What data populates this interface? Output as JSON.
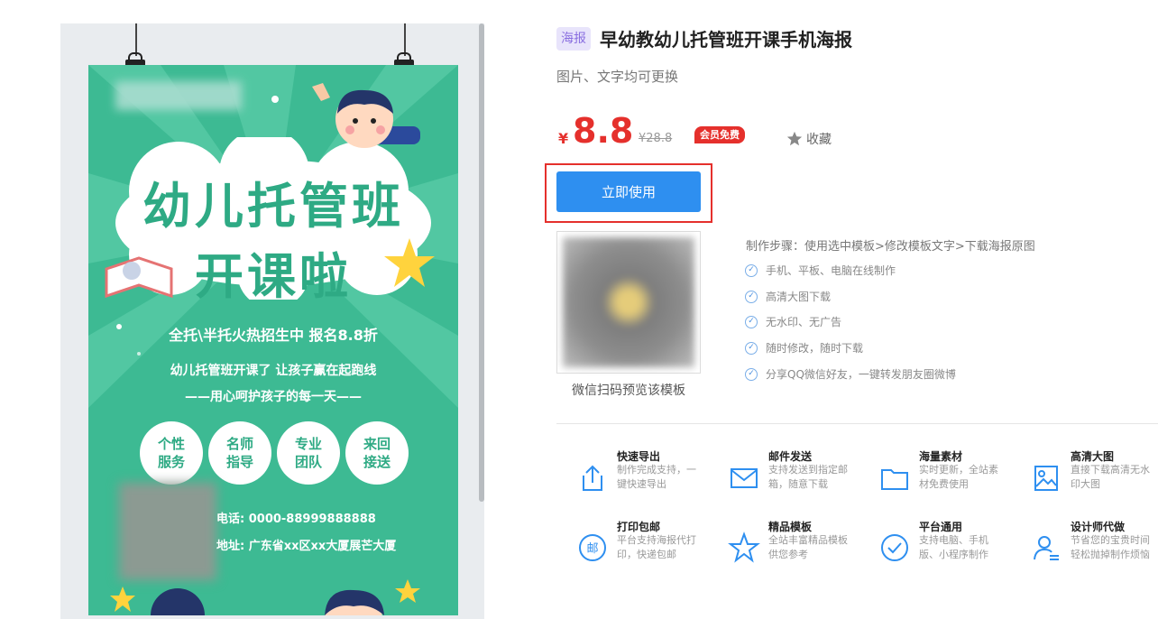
{
  "preview": {
    "poster": {
      "title_line1": "幼儿托管班",
      "title_line2": "开课啦",
      "line1": "全托\\半托火热招生中 报名8.8折",
      "line2": "幼儿托管班开课了 让孩子赢在起跑线",
      "line3": "——用心呵护孩子的每一天——",
      "circles": [
        {
          "line1": "个性",
          "line2": "服务"
        },
        {
          "line1": "名师",
          "line2": "指导"
        },
        {
          "line1": "专业",
          "line2": "团队"
        },
        {
          "line1": "来回",
          "line2": "接送"
        }
      ],
      "phone": "电话: 0000-88999888888",
      "address": "地址: 广东省xx区xx大厦展芒大厦",
      "colors": {
        "background": "#3dba93",
        "title": "#2eaa84"
      }
    }
  },
  "product": {
    "tag": "海报",
    "title": "早幼教幼儿托管班开课手机海报",
    "subtitle": "图片、文字均可更换",
    "currency": "¥",
    "price": "8.8",
    "old_price": "¥28.8",
    "vip_badge": "会员免费",
    "favorite_label": "收藏",
    "use_button": "立即使用",
    "qr_caption": "微信扫码预览该模板",
    "steps_title": "制作步骤：使用选中模板>修改模板文字>下载海报原图",
    "features": [
      "手机、平板、电脑在线制作",
      "高清大图下载",
      "无水印、无广告",
      "随时修改，随时下载",
      "分享QQ微信好友，一键转发朋友圈微博"
    ],
    "accent_color": "#2e8ff0",
    "price_color": "#e5302c"
  },
  "services": [
    {
      "icon": "upload-icon",
      "title": "快速导出",
      "desc": "制作完成支持，一键快速导出"
    },
    {
      "icon": "mail-icon",
      "title": "邮件发送",
      "desc": "支持发送到指定邮箱，随意下载"
    },
    {
      "icon": "folder-icon",
      "title": "海量素材",
      "desc": "实时更新，全站素材免费使用"
    },
    {
      "icon": "image-icon",
      "title": "高清大图",
      "desc": "直接下载高清无水印大图"
    },
    {
      "icon": "postmark-icon",
      "title": "打印包邮",
      "desc": "平台支持海报代打印，快递包邮"
    },
    {
      "icon": "star-icon",
      "title": "精品模板",
      "desc": "全站丰富精品模板供您参考"
    },
    {
      "icon": "check-circle-icon",
      "title": "平台通用",
      "desc": "支持电脑、手机版、小程序制作"
    },
    {
      "icon": "designer-icon",
      "title": "设计师代做",
      "desc": "节省您的宝贵时间轻松抛掉制作烦恼"
    }
  ]
}
